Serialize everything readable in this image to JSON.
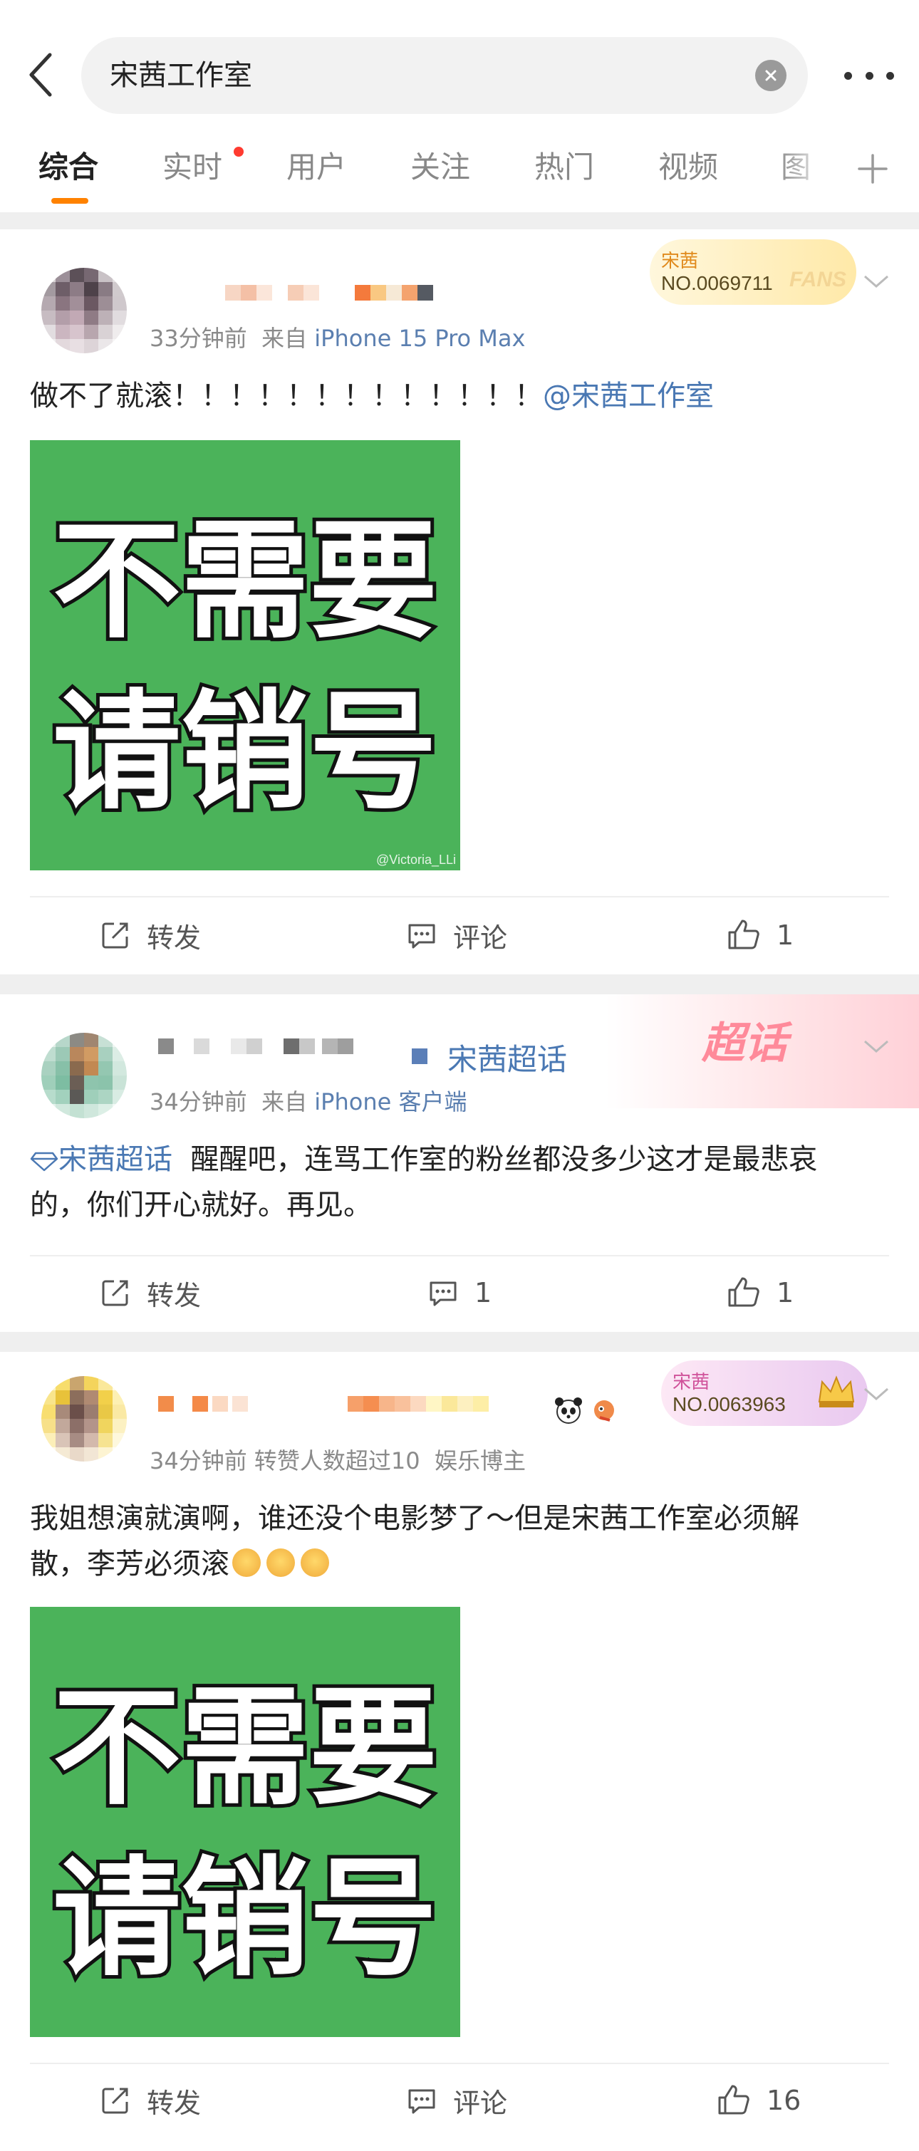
{
  "search": {
    "query": "宋茜工作室"
  },
  "tabs": [
    "综合",
    "实时",
    "用户",
    "关注",
    "热门",
    "视频",
    "图"
  ],
  "posts": [
    {
      "time": "33分钟前",
      "from": "来自",
      "source": "iPhone 15 Pro Max",
      "text": "做不了就滚！！！！！！！！！！！！！",
      "mention": "@宋茜工作室",
      "badge": {
        "name": "宋茜",
        "no": "NO.0069711",
        "word": "FANS"
      },
      "image": {
        "line1": "不需要",
        "line2": "请销号",
        "watermark": "@Victoria_LLi"
      },
      "actions": {
        "repost": "转发",
        "comment": "评论",
        "like": "1"
      }
    },
    {
      "topic_tag": "宋茜超话",
      "topic_banner": "超话",
      "time": "34分钟前",
      "from": "来自",
      "source": "iPhone 客户端",
      "inline_topic": "宋茜超话",
      "text_line1": "醒醒吧，连骂工作室的粉丝都没多少这才是最悲哀",
      "text_line2": "的，你们开心就好。再见。",
      "actions": {
        "repost": "转发",
        "comment": "1",
        "like": "1"
      }
    },
    {
      "time": "34分钟前",
      "meta_extra": "转赞人数超过10",
      "meta_role": "娱乐博主",
      "text_line1": "我姐想演就演啊，谁还没个电影梦了～但是宋茜工作室必须解",
      "text_line2": "散，李芳必须滚",
      "badge": {
        "name": "宋茜",
        "no": "NO.0063963"
      },
      "image": {
        "line1": "不需要",
        "line2": "请销号"
      },
      "actions": {
        "repost": "转发",
        "comment": "评论",
        "like": "16"
      }
    }
  ],
  "colors": {
    "accent": "#ff8200",
    "link": "#4a78b3",
    "image_green": "#4bb35a"
  }
}
